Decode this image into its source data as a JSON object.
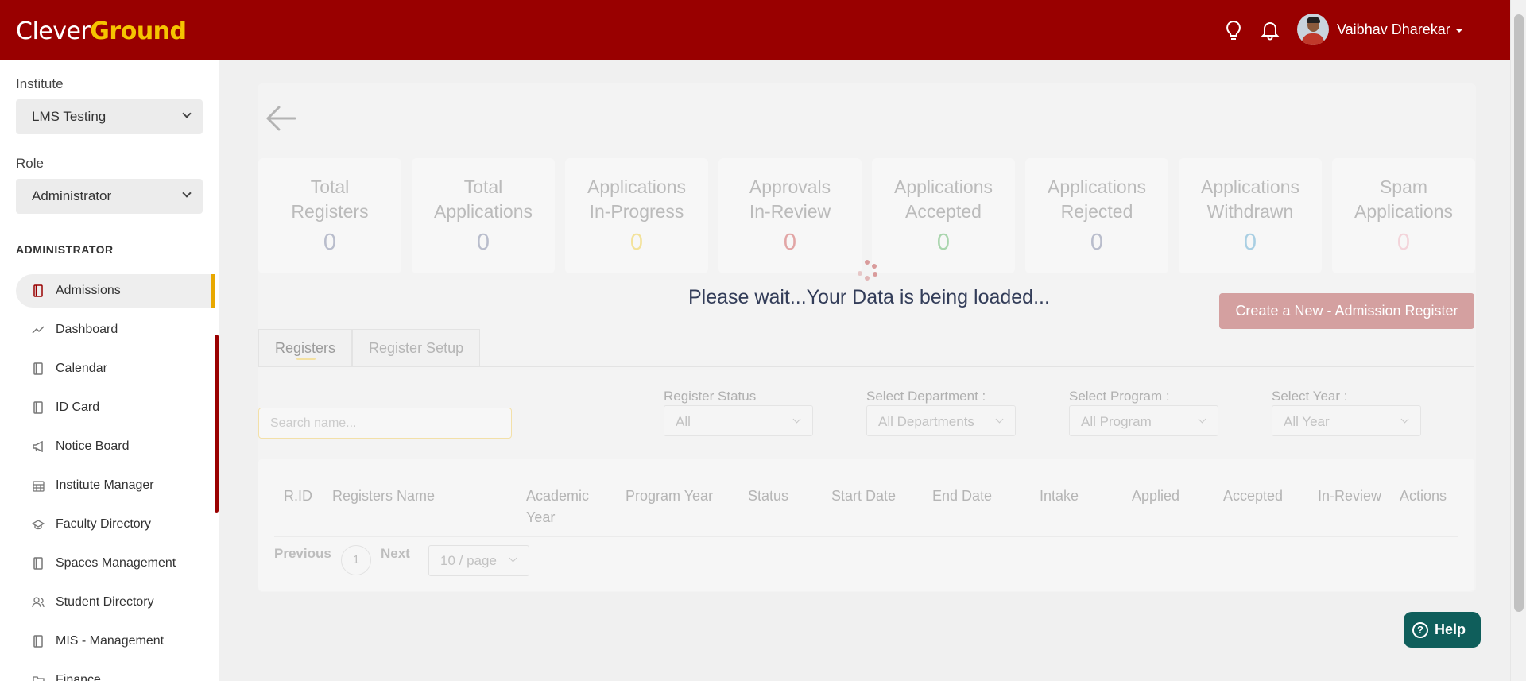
{
  "header": {
    "logo_part1": "Clever",
    "logo_part2": "Ground",
    "user_name": "Vaibhav Dharekar",
    "icons": [
      "lightbulb-icon",
      "bell-icon",
      "avatar",
      "caret-down-icon"
    ],
    "colors": {
      "brand": "#990000",
      "logo_accent": "#f5c400"
    }
  },
  "sidebar": {
    "institute_label": "Institute",
    "institute_value": "LMS Testing",
    "role_label": "Role",
    "role_value": "Administrator",
    "section_title": "ADMINISTRATOR",
    "items": [
      {
        "label": "Admissions",
        "icon": "book-icon",
        "active": true
      },
      {
        "label": "Dashboard",
        "icon": "trend-icon"
      },
      {
        "label": "Calendar",
        "icon": "book-icon"
      },
      {
        "label": "ID Card",
        "icon": "book-icon"
      },
      {
        "label": "Notice Board",
        "icon": "megaphone-icon"
      },
      {
        "label": "Institute Manager",
        "icon": "calendar-grid-icon"
      },
      {
        "label": "Faculty Directory",
        "icon": "graduation-cap-icon"
      },
      {
        "label": "Spaces Management",
        "icon": "book-icon"
      },
      {
        "label": "Student Directory",
        "icon": "users-icon"
      },
      {
        "label": "MIS - Management",
        "icon": "book-icon"
      },
      {
        "label": "Finance",
        "icon": "folder-icon"
      }
    ]
  },
  "stats": [
    {
      "title1": "Total",
      "title2": "Registers",
      "value": "0",
      "color": "#b9bdcc"
    },
    {
      "title1": "Total",
      "title2": "Applications",
      "value": "0",
      "color": "#b9bdcc"
    },
    {
      "title1": "Applications",
      "title2": "In-Progress",
      "value": "0",
      "color": "#f3e29a"
    },
    {
      "title1": "Approvals",
      "title2": "In-Review",
      "value": "0",
      "color": "#e2a6a6"
    },
    {
      "title1": "Applications",
      "title2": "Accepted",
      "value": "0",
      "color": "#a9d5ad"
    },
    {
      "title1": "Applications",
      "title2": "Rejected",
      "value": "0",
      "color": "#b9bdcc"
    },
    {
      "title1": "Applications",
      "title2": "Withdrawn",
      "value": "0",
      "color": "#a9cfe3"
    },
    {
      "title1": "Spam",
      "title2": "Applications",
      "value": "0",
      "color": "#f3d4da"
    }
  ],
  "loading_text": "Please wait...Your Data is being loaded...",
  "create_button": "Create a New - Admission Register",
  "tabs": [
    "Registers",
    "Register Setup"
  ],
  "search": {
    "placeholder": "Search name..."
  },
  "filters": [
    {
      "label": "Register Status",
      "value": "All"
    },
    {
      "label": "Select Department :",
      "value": "All Departments"
    },
    {
      "label": "Select Program :",
      "value": "All Program"
    },
    {
      "label": "Select Year :",
      "value": "All Year"
    }
  ],
  "table": {
    "columns": [
      "R.ID",
      "Registers Name",
      "Academic Year",
      "Program Year",
      "Status",
      "Start Date",
      "End Date",
      "Intake",
      "Applied",
      "Accepted",
      "In-Review",
      "Actions"
    ]
  },
  "pagination": {
    "previous": "Previous",
    "page": "1",
    "next": "Next",
    "per_page": "10 / page"
  },
  "help_label": "Help"
}
